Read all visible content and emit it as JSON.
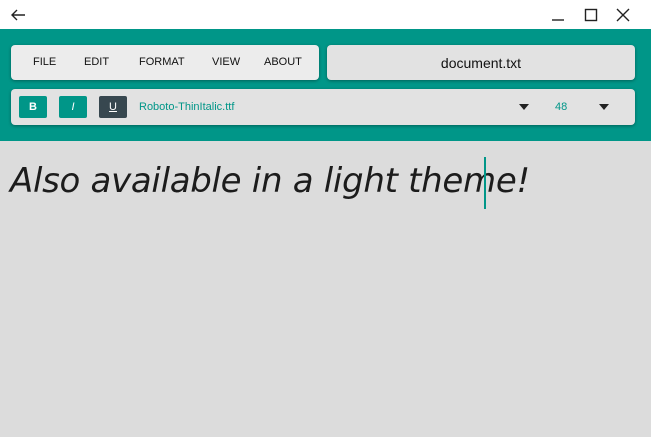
{
  "window": {
    "back_icon": "back-arrow-icon",
    "minimize_icon": "minimize-icon",
    "maximize_icon": "maximize-icon",
    "close_icon": "close-icon"
  },
  "menu": {
    "items": [
      "FILE",
      "EDIT",
      "FORMAT",
      "VIEW",
      "ABOUT"
    ]
  },
  "filename": "document.txt",
  "toolbar": {
    "bold_label": "B",
    "italic_label": "I",
    "underline_label": "U",
    "font_name": "Roboto-ThinItalic.ttf",
    "font_size": "48"
  },
  "editor": {
    "text": "Also available in a light theme!"
  },
  "colors": {
    "accent": "#009688",
    "underline_button": "#37474f",
    "editor_bg": "#dcdcdc"
  }
}
